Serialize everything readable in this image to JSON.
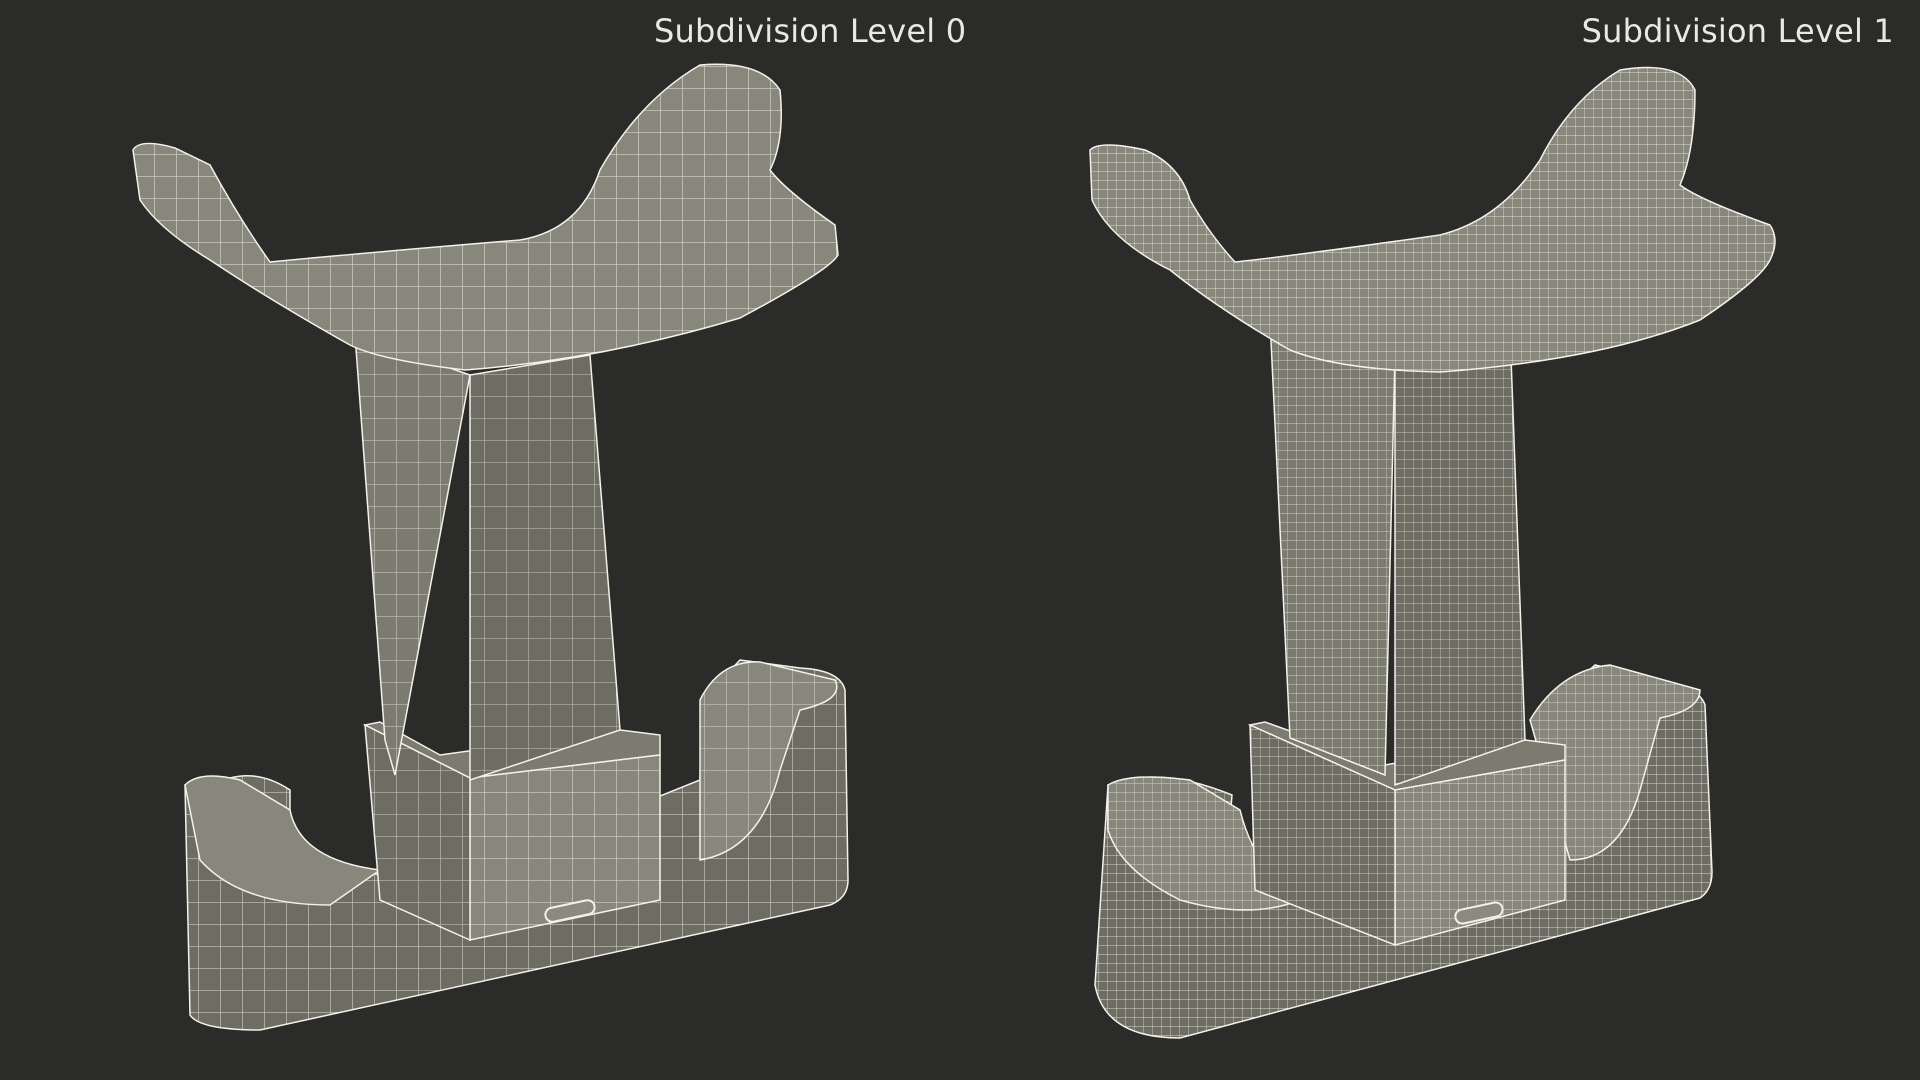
{
  "labels": {
    "left": "Subdivision Level 0",
    "right": "Subdivision Level 1"
  },
  "colors": {
    "background": "#2b2b2a",
    "mesh_fill": "#7b7b70",
    "wire": "#f2f0e6",
    "label_text": "#e8e8e4"
  },
  "models": [
    {
      "name": "headset-stand-level-0",
      "wire_density": 1
    },
    {
      "name": "headset-stand-level-1",
      "wire_density": 2
    }
  ]
}
